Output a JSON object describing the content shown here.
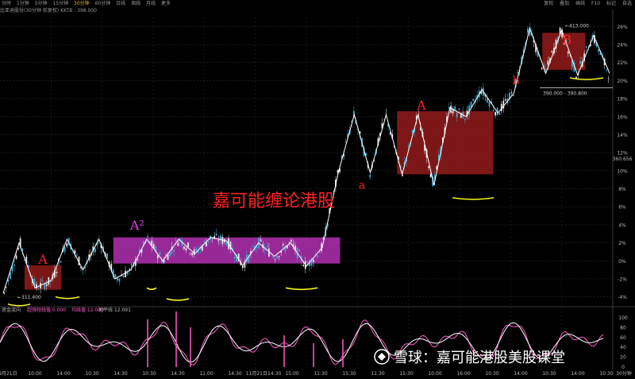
{
  "toolbar": {
    "items": [
      "分时",
      "1分钟",
      "5分钟",
      "15分钟",
      "30分钟",
      "60分钟",
      "日线",
      "周线",
      "月线",
      "更多"
    ],
    "active_index": 4,
    "right_items": [
      "复权",
      "叠加",
      "画线",
      "F10",
      "标记",
      "自选"
    ]
  },
  "info": {
    "line": "比亚迪股份(30分钟 前复权) KKTB : 398.000"
  },
  "colors": {
    "background": "#000000",
    "grid": "#2a2a2a",
    "up_candle": "#e8e8e8",
    "down_candle": "#3ab0d8",
    "zigzag": "#ffffff",
    "a_box": "#8b1a1a",
    "a2_box": "#b030b0",
    "annotation_red": "#ff2020",
    "annotation_magenta": "#e040e0",
    "underline_yellow": "#f5f51a",
    "price_line": "#ffffff",
    "indicator_line_1": "#ffffff",
    "indicator_line_2": "#ff5cc8"
  },
  "chart_data": {
    "type": "candlestick",
    "y_axis": {
      "ticks": [
        "26%",
        "24%",
        "22%",
        "20%",
        "18%",
        "16%",
        "14%",
        "12%",
        "10%",
        "8%",
        "6%",
        "4%",
        "2%",
        "0%",
        "-2%",
        "-4%"
      ],
      "range_pct": [
        -5,
        27
      ]
    },
    "price_label_right": "360.656",
    "zigzag_pct": [
      -3.6,
      2.0,
      -3.0,
      -2.2,
      2.4,
      -1.0,
      2.4,
      -2.0,
      -1.0,
      2.4,
      0.0,
      2.4,
      0.8,
      2.6,
      2.2,
      -0.5,
      2.0,
      0.5,
      2.0,
      -0.6,
      1.5,
      9.8,
      16.2,
      9.8,
      16.2,
      9.6,
      16.2,
      8.4,
      17.0,
      16.0,
      19.0,
      16.4,
      18.6,
      25.8,
      20.8,
      25.6,
      20.6,
      25.0,
      20.8
    ],
    "boxes": [
      {
        "label": "A",
        "low_pct": -3.2,
        "high_pct": -0.5,
        "x0": 0.04,
        "x1": 0.1
      },
      {
        "label": "A²",
        "low_pct": -0.3,
        "high_pct": 2.6,
        "x0": 0.185,
        "x1": 0.555
      },
      {
        "label": "A",
        "low_pct": 9.6,
        "high_pct": 16.6,
        "x0": 0.648,
        "x1": 0.805
      },
      {
        "label": "B",
        "low_pct": 21.2,
        "high_pct": 25.3,
        "x0": 0.885,
        "x1": 0.955
      }
    ],
    "annotations": {
      "a_label_lower": "a",
      "b_label": "b",
      "watermark_title": "嘉可能缠论港股",
      "low_label": "311.400",
      "high_label": "413.000",
      "range_label": "390.000 - 390.800"
    },
    "indicator": {
      "header_name": "资金流向",
      "header_value_label": "超强短线值 0.000",
      "mid_label": "均线值 12.000",
      "right_label": "地平线 12.091",
      "ticks": [
        "100",
        "80",
        "60",
        "40",
        "20",
        "0"
      ]
    },
    "x_axis_labels": [
      "09月21日",
      "10:00",
      "14:00",
      "10:30",
      "14:30",
      "10:30",
      "14:30",
      "11:00",
      "14:30",
      "11月21日14:30",
      "15:00",
      "11:30",
      "15:30",
      "11:30",
      "15:30",
      "10:00",
      "16:00",
      "10:30",
      "14:00",
      "10:30",
      "14:00",
      "10:30"
    ],
    "x_axis_right_label": "30分钟"
  },
  "footer": {
    "watermark": "雪球：嘉可能港股美股课堂"
  }
}
